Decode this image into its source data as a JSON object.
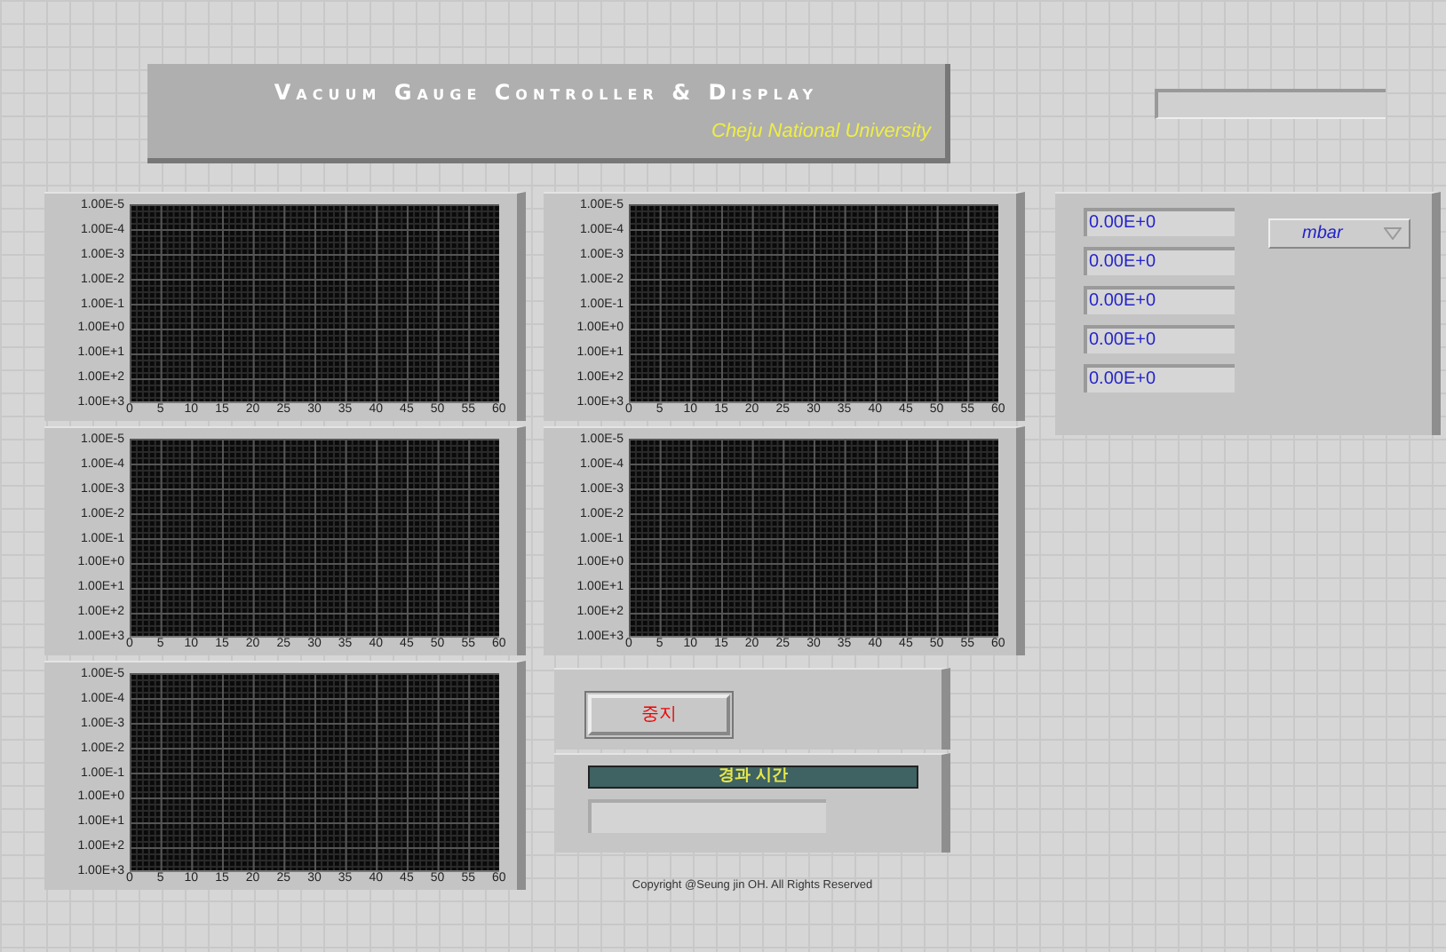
{
  "banner": {
    "title": "Vacuum Gauge Controller & Display",
    "subtitle": "Cheju National University"
  },
  "charts": [
    {
      "y_labels": [
        "1.00E-5",
        "1.00E-4",
        "1.00E-3",
        "1.00E-2",
        "1.00E-1",
        "1.00E+0",
        "1.00E+1",
        "1.00E+2",
        "1.00E+3"
      ],
      "x_labels": [
        "0",
        "5",
        "10",
        "15",
        "20",
        "25",
        "30",
        "35",
        "40",
        "45",
        "50",
        "55",
        "60"
      ]
    },
    {
      "y_labels": [
        "1.00E-5",
        "1.00E-4",
        "1.00E-3",
        "1.00E-2",
        "1.00E-1",
        "1.00E+0",
        "1.00E+1",
        "1.00E+2",
        "1.00E+3"
      ],
      "x_labels": [
        "0",
        "5",
        "10",
        "15",
        "20",
        "25",
        "30",
        "35",
        "40",
        "45",
        "50",
        "55",
        "60"
      ]
    },
    {
      "y_labels": [
        "1.00E-5",
        "1.00E-4",
        "1.00E-3",
        "1.00E-2",
        "1.00E-1",
        "1.00E+0",
        "1.00E+1",
        "1.00E+2",
        "1.00E+3"
      ],
      "x_labels": [
        "0",
        "5",
        "10",
        "15",
        "20",
        "25",
        "30",
        "35",
        "40",
        "45",
        "50",
        "55",
        "60"
      ]
    },
    {
      "y_labels": [
        "1.00E-5",
        "1.00E-4",
        "1.00E-3",
        "1.00E-2",
        "1.00E-1",
        "1.00E+0",
        "1.00E+1",
        "1.00E+2",
        "1.00E+3"
      ],
      "x_labels": [
        "0",
        "5",
        "10",
        "15",
        "20",
        "25",
        "30",
        "35",
        "40",
        "45",
        "50",
        "55",
        "60"
      ]
    },
    {
      "y_labels": [
        "1.00E-5",
        "1.00E-4",
        "1.00E-3",
        "1.00E-2",
        "1.00E-1",
        "1.00E+0",
        "1.00E+1",
        "1.00E+2",
        "1.00E+3"
      ],
      "x_labels": [
        "0",
        "5",
        "10",
        "15",
        "20",
        "25",
        "30",
        "35",
        "40",
        "45",
        "50",
        "55",
        "60"
      ]
    }
  ],
  "readings": [
    "0.00E+0",
    "0.00E+0",
    "0.00E+0",
    "0.00E+0",
    "0.00E+0"
  ],
  "unit_selector": {
    "value": "mbar"
  },
  "stop_button": "중지",
  "elapsed_time": {
    "label": "경과 시간"
  },
  "copyright": "Copyright @Seung jin OH. All Rights Reserved"
}
